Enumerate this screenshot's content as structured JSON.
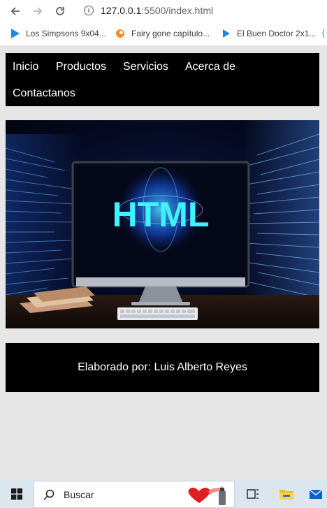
{
  "browser": {
    "url_host": "127.0.0.1",
    "url_port_path": ":5500/index.html",
    "bookmarks": [
      {
        "label": "Los Simpsons 9x04..."
      },
      {
        "label": "Fairy gone capítulo..."
      },
      {
        "label": "El Buen Doctor 2x1..."
      }
    ]
  },
  "nav": {
    "items": [
      "Inicio",
      "Productos",
      "Servicios",
      "Acerca de",
      "Contactanos"
    ]
  },
  "hero": {
    "screen_text": "HTML"
  },
  "footer": {
    "text": "Elaborado por: Luis Alberto Reyes"
  },
  "taskbar": {
    "search_label": "Buscar"
  }
}
